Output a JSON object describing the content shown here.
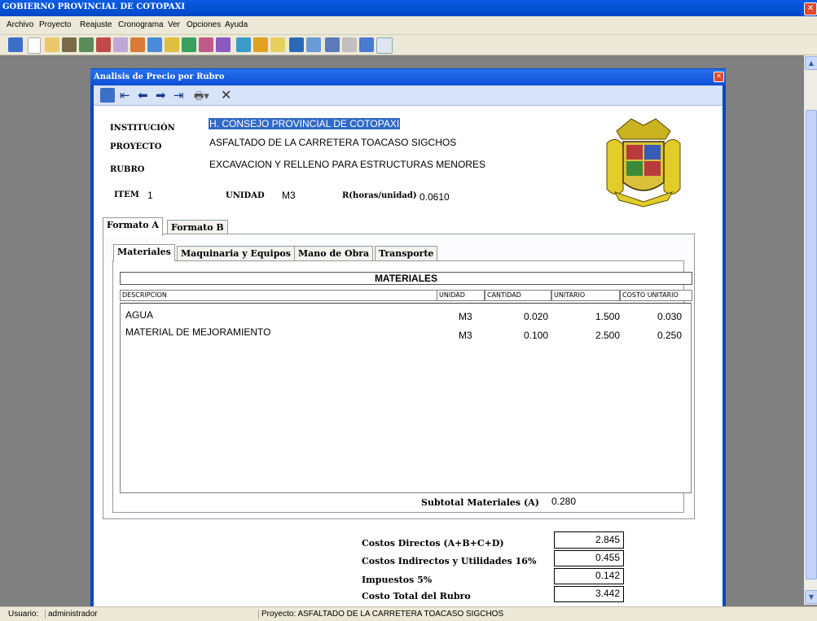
{
  "app": {
    "title": "GOBIERNO PROVINCIAL DE COTOPAXI"
  },
  "menu": [
    "Archivo",
    "Proyecto",
    "Reajuste",
    "Cronograma",
    "Ver",
    "Opciones",
    "Ayuda"
  ],
  "window": {
    "title": "Analisis de Precio por Rubro"
  },
  "header": {
    "institucion_label": "INSTITUCIÓN",
    "institucion_value": "H. CONSEJO PROVINCIAL DE COTOPAXI",
    "proyecto_label": "PROYECTO",
    "proyecto_value": "ASFALTADO DE LA CARRETERA TOACASO SIGCHOS",
    "rubro_label": "RUBRO",
    "rubro_value": "EXCAVACION Y RELLENO PARA ESTRUCTURAS MENORES",
    "item_label": "ITEM",
    "item_value": "1",
    "unidad_label": "UNIDAD",
    "unidad_value": "M3",
    "r_label": "R(horas/unidad)",
    "r_value": "0.0610"
  },
  "format_tabs": [
    "Formato A",
    "Formato B"
  ],
  "sub_tabs": [
    "Materiales",
    "Maquinaria y Equipos",
    "Mano de Obra",
    "Transporte"
  ],
  "table": {
    "title": "MATERIALES",
    "columns": [
      "DESCRIPCION",
      "UNIDAD",
      "CANTIDAD",
      "UNITARIO",
      "COSTO UNITARIO"
    ],
    "rows": [
      {
        "descripcion": "AGUA",
        "unidad": "M3",
        "cantidad": "0.020",
        "unitario": "1.500",
        "costo": "0.030"
      },
      {
        "descripcion": "MATERIAL DE MEJORAMIENTO",
        "unidad": "M3",
        "cantidad": "0.100",
        "unitario": "2.500",
        "costo": "0.250"
      }
    ]
  },
  "subtotal": {
    "label": "Subtotal Materiales (A)",
    "value": "0.280"
  },
  "totals": [
    {
      "label": "Costos Directos (A+B+C+D)",
      "value": "2.845"
    },
    {
      "label": "Costos Indirectos y Utilidades 16%",
      "value": "0.455"
    },
    {
      "label": "Impuestos 5%",
      "value": "0.142"
    },
    {
      "label": "Costo Total del Rubro",
      "value": "3.442"
    }
  ],
  "status": {
    "user_label": "Usuario:",
    "user_value": "administrador",
    "project": "Proyecto: ASFALTADO DE LA CARRETERA TOACASO SIGCHOS"
  }
}
